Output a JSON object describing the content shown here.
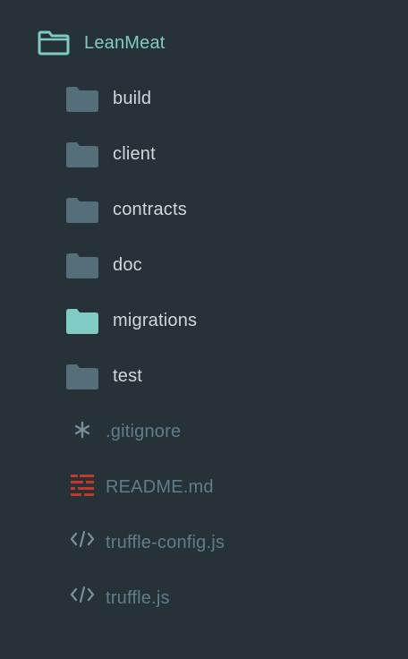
{
  "colors": {
    "background": "#263238",
    "accent": "#80cbc4",
    "folder_closed": "#546e7a",
    "folder_highlight": "#80cbc4",
    "folder_label": "#cfd8dc",
    "file_label": "#607d8b",
    "readme_icon": "#c0392b",
    "code_icon": "#78909c"
  },
  "tree": {
    "root": {
      "label": "LeanMeat",
      "icon": "folder-open-outline-icon"
    },
    "folders": [
      {
        "label": "build",
        "icon": "folder-icon"
      },
      {
        "label": "client",
        "icon": "folder-icon"
      },
      {
        "label": "contracts",
        "icon": "folder-icon"
      },
      {
        "label": "doc",
        "icon": "folder-icon"
      },
      {
        "label": "migrations",
        "icon": "folder-icon",
        "highlight": true
      },
      {
        "label": "test",
        "icon": "folder-icon"
      }
    ],
    "files": [
      {
        "label": ".gitignore",
        "icon": "asterisk-icon"
      },
      {
        "label": "README.md",
        "icon": "readme-icon"
      },
      {
        "label": "truffle-config.js",
        "icon": "code-icon"
      },
      {
        "label": "truffle.js",
        "icon": "code-icon"
      }
    ]
  }
}
